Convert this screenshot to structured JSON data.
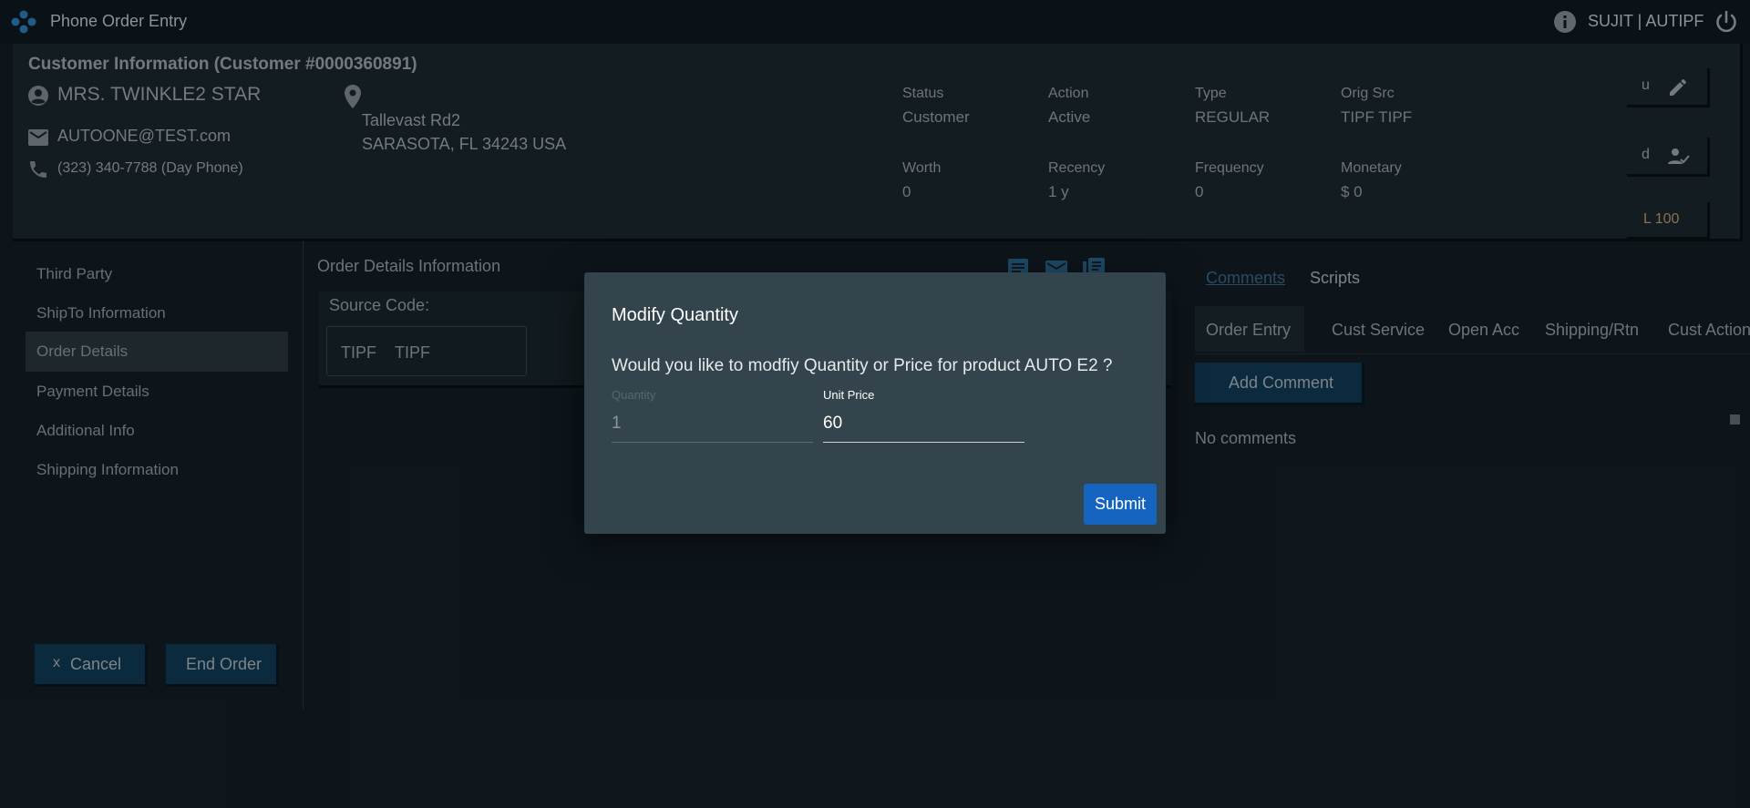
{
  "header": {
    "app_title": "Phone Order Entry",
    "user": "SUJIT | AUTIPF"
  },
  "customer": {
    "title": "Customer Information (Customer #0000360891)",
    "name": "MRS. TWINKLE2 STAR",
    "email": "AUTOONE@TEST.com",
    "phone": "(323) 340-7788 (Day Phone)",
    "address_line1": "Tallevast Rd2",
    "address_line2": "SARASOTA, FL 34243 USA",
    "stats": [
      {
        "label": "Status",
        "value": "Customer"
      },
      {
        "label": "Action",
        "value": "Active"
      },
      {
        "label": "Type",
        "value": "REGULAR"
      },
      {
        "label": "Orig Src",
        "value": "TIPF TIPF"
      },
      {
        "label": "Worth",
        "value": "0"
      },
      {
        "label": "Recency",
        "value": "1 y"
      },
      {
        "label": "Frequency",
        "value": "0"
      },
      {
        "label": "Monetary",
        "value": "$ 0"
      }
    ],
    "side_buttons": {
      "u": "u",
      "d": "d",
      "l": "L 100"
    }
  },
  "left_nav": {
    "items": [
      "Third Party",
      "ShipTo Information",
      "Order Details",
      "Payment Details",
      "Additional Info",
      "Shipping Information"
    ],
    "active_index": 2,
    "cancel_label": "Cancel",
    "cancel_prefix": "x",
    "end_order_label": "End Order"
  },
  "order_details": {
    "title": "Order Details Information",
    "source_code_label": "Source Code:",
    "source_code_values": [
      "TIPF",
      "TIPF"
    ]
  },
  "right_panel": {
    "tabs_top": [
      "Comments",
      "Scripts"
    ],
    "tabs": [
      "Order Entry",
      "Cust Service",
      "Open Acc",
      "Shipping/Rtn",
      "Cust Action"
    ],
    "add_comment_label": "Add Comment",
    "empty_text": "No comments"
  },
  "dialog": {
    "title": "Modify Quantity",
    "message": "Would you like to modfiy Quantity or Price for product AUTO E2 ?",
    "quantity_label": "Quantity",
    "quantity_value": "1",
    "unit_price_label": "Unit Price",
    "unit_price_value": "60",
    "submit_label": "Submit"
  },
  "colors": {
    "accent": "#1565c0",
    "brand_icon": "#2f88c8",
    "background": "#142029"
  }
}
